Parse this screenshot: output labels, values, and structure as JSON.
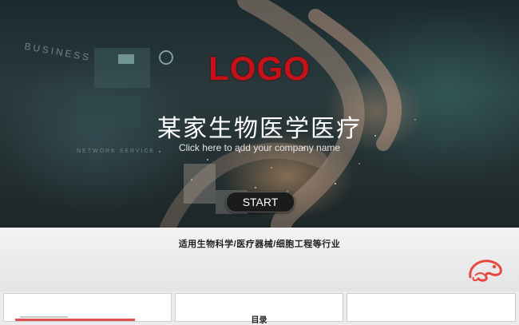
{
  "hero": {
    "logo": "LOGO",
    "title": "某家生物医学医疗",
    "subtitle": "Click here to add your company name",
    "start_button": "START",
    "bg_text_business": "BUSINESS",
    "bg_text_network": "NETWORK SERVICE"
  },
  "band": {
    "industry_text": "适用生物科学/医疗器械/细胞工程等行业"
  },
  "thumbnails": {
    "toc_label": "目录"
  },
  "colors": {
    "logo_red": "#c3121a",
    "chameleon_red": "#e8463f"
  }
}
